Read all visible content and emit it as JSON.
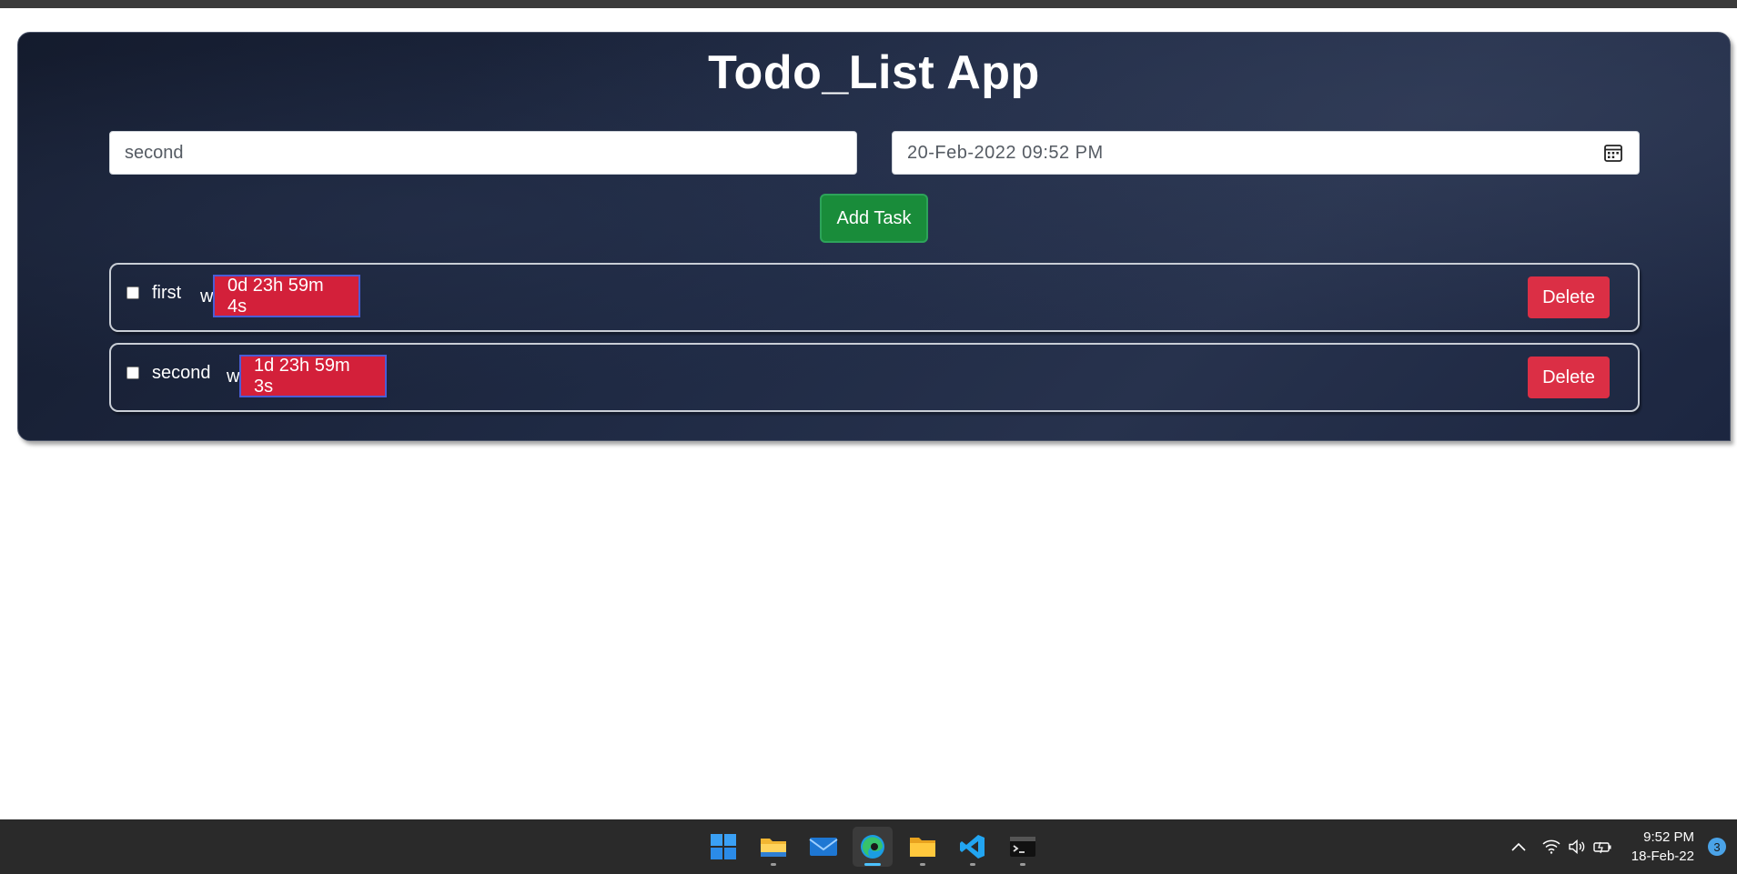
{
  "app": {
    "title": "Todo_List App"
  },
  "form": {
    "task_input_value": "second",
    "date_value": "20-Feb-2022 09:52 PM",
    "add_button_label": "Add Task"
  },
  "tasks": [
    {
      "name": "first",
      "trail": "w",
      "countdown": "0d 23h 59m 4s",
      "delete_label": "Delete",
      "checked": false
    },
    {
      "name": "second",
      "trail": "w",
      "countdown": "1d 23h 59m 3s",
      "delete_label": "Delete",
      "checked": false
    }
  ],
  "taskbar": {
    "apps": [
      "windows-start-icon",
      "file-explorer-icon",
      "mail-icon",
      "edge-browser-icon",
      "folder-icon",
      "vscode-icon",
      "terminal-icon"
    ],
    "active_app": "edge-browser-icon",
    "clock_time": "9:52 PM",
    "clock_date": "18-Feb-22",
    "notification_count": "3"
  },
  "colors": {
    "add_button": "#198c3a",
    "delete_button": "#db2f45",
    "countdown_badge": "#d3203a",
    "panel": "#1f2a44"
  }
}
